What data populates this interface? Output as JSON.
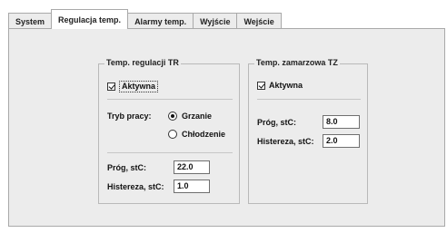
{
  "tabs": [
    {
      "label": "System"
    },
    {
      "label": "Regulacja temp."
    },
    {
      "label": "Alarmy temp."
    },
    {
      "label": "Wyjście"
    },
    {
      "label": "Wejście"
    }
  ],
  "active_tab": "Regulacja temp.",
  "tr_group": {
    "title": "Temp. regulacji TR",
    "active_label": "Aktywna",
    "active_checked": true,
    "mode_label": "Tryb pracy:",
    "mode_options": [
      "Grzanie",
      "Chłodzenie"
    ],
    "mode_selected": "Grzanie",
    "threshold_label": "Próg, stC:",
    "threshold_value": "22.0",
    "hysteresis_label": "Histereza, stC:",
    "hysteresis_value": "1.0"
  },
  "tz_group": {
    "title": "Temp. zamarzowa TZ",
    "active_label": "Aktywna",
    "active_checked": true,
    "threshold_label": "Próg, stC:",
    "threshold_value": "8.0",
    "hysteresis_label": "Histereza, stC:",
    "hysteresis_value": "2.0"
  }
}
